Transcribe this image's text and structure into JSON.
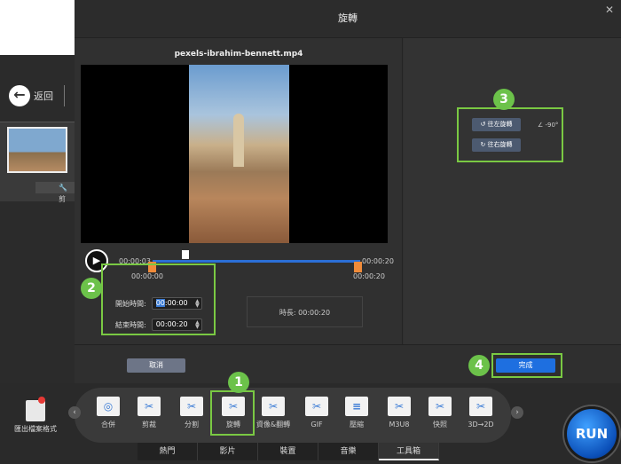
{
  "background_app": {
    "back_label": "返回",
    "file_bar_label": "🔧 剪"
  },
  "dialog": {
    "title": "旋轉",
    "close_icon": "close-icon",
    "file_name": "pexels-ibrahim-bennett.mp4",
    "timeline": {
      "current_time": "00:00:03",
      "end_time": "00:00:20",
      "start_marker": "00:00:00",
      "end_marker": "00:00:20"
    },
    "start_time_label": "開始時間:",
    "start_time_value_selected": "00",
    "start_time_value_rest": ":00:00",
    "end_time_label": "結束時間:",
    "end_time_value": "00:00:20",
    "duration_text": "時長: 00:00:20",
    "rotate_left_label": "往左旋轉",
    "rotate_right_label": "往右旋轉",
    "angle_text": "∠ -90°",
    "cancel_label": "取消",
    "done_label": "完成"
  },
  "toolbar": {
    "export_label": "匯出檔案格式",
    "tools": [
      {
        "label": "合併"
      },
      {
        "label": "剪裁"
      },
      {
        "label": "分割"
      },
      {
        "label": "旋轉"
      },
      {
        "label": "資像&翻轉"
      },
      {
        "label": "GIF"
      },
      {
        "label": "壓縮"
      },
      {
        "label": "M3U8"
      },
      {
        "label": "快照"
      },
      {
        "label": "3D→2D"
      }
    ],
    "tabs": [
      "熱門",
      "影片",
      "裝置",
      "音樂",
      "工具箱"
    ],
    "run_label": "RUN"
  },
  "annotations": [
    "1",
    "2",
    "3",
    "4"
  ],
  "colors": {
    "accent_blue": "#1e6fe0",
    "highlight_green": "#7ac943",
    "trim_orange": "#f08b3a"
  }
}
